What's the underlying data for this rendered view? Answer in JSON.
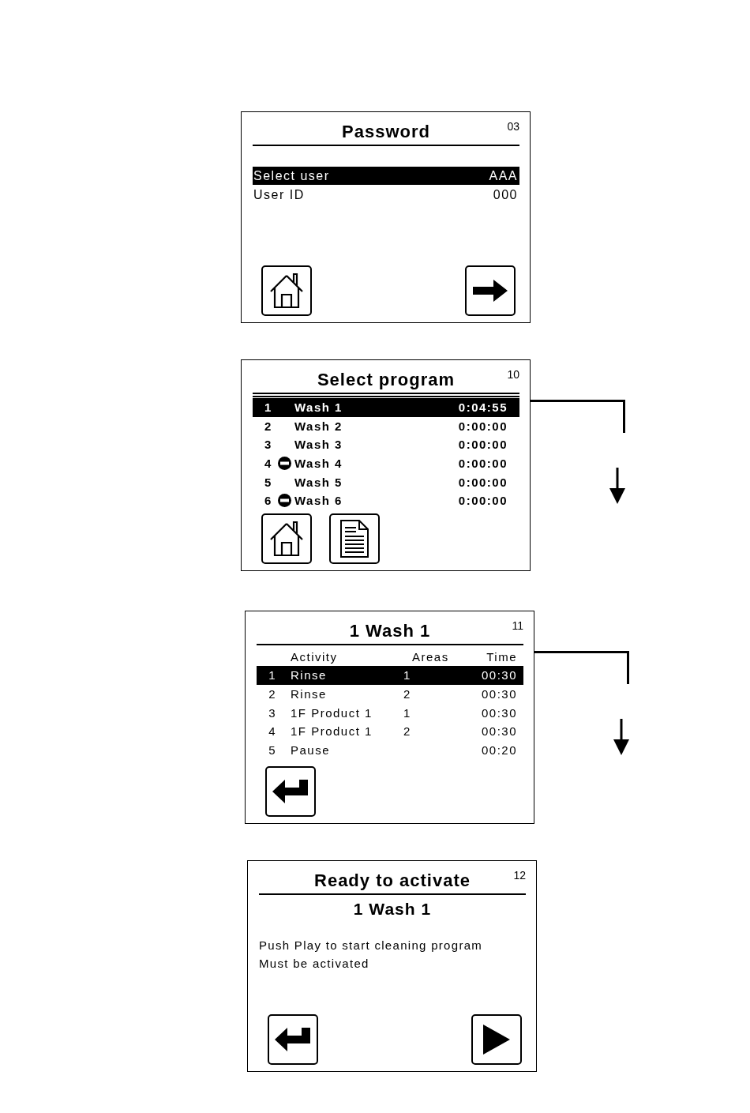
{
  "screens": [
    {
      "kind": "password",
      "number": "03",
      "title": "Password",
      "rows": [
        {
          "label": "Select user",
          "value": "AAA",
          "selected": true
        },
        {
          "label": "User ID",
          "value": "000",
          "selected": false
        }
      ],
      "buttons": [
        {
          "kind": "home"
        },
        {
          "kind": "next"
        }
      ]
    },
    {
      "kind": "program_list",
      "number": "10",
      "title": "Select program",
      "flow_arrow": true,
      "rows": [
        {
          "number": "1",
          "name": "Wash 1",
          "blocked": false,
          "time": "0:04:55",
          "selected": true
        },
        {
          "number": "2",
          "name": "Wash 2",
          "blocked": false,
          "time": "0:00:00",
          "selected": false
        },
        {
          "number": "3",
          "name": "Wash 3",
          "blocked": false,
          "time": "0:00:00",
          "selected": false
        },
        {
          "number": "4",
          "name": "Wash 4",
          "blocked": true,
          "time": "0:00:00",
          "selected": false
        },
        {
          "number": "5",
          "name": "Wash 5",
          "blocked": false,
          "time": "0:00:00",
          "selected": false
        },
        {
          "number": "6",
          "name": "Wash 6",
          "blocked": true,
          "time": "0:00:00",
          "selected": false
        }
      ],
      "buttons": [
        {
          "kind": "home"
        },
        {
          "kind": "document"
        }
      ]
    },
    {
      "kind": "activity_list",
      "number": "11",
      "title": "1 Wash 1",
      "flow_arrow": true,
      "columns": [
        "Activity",
        "Areas",
        "Time"
      ],
      "rows": [
        {
          "number": "1",
          "activity": "Rinse",
          "areas": "1",
          "time": "00:30",
          "selected": true
        },
        {
          "number": "2",
          "activity": "Rinse",
          "areas": "2",
          "time": "00:30",
          "selected": false
        },
        {
          "number": "3",
          "activity": "1F Product 1",
          "areas": "1",
          "time": "00:30",
          "selected": false
        },
        {
          "number": "4",
          "activity": "1F Product 1",
          "areas": "2",
          "time": "00:30",
          "selected": false
        },
        {
          "number": "5",
          "activity": "Pause",
          "time": "00:20",
          "selected": false
        }
      ],
      "buttons": [
        {
          "kind": "back"
        }
      ]
    },
    {
      "kind": "message",
      "number": "12",
      "title": "Ready to activate",
      "subtitle": "1 Wash 1",
      "lines": [
        "Push Play to start cleaning program",
        "Must be activated"
      ],
      "buttons": [
        {
          "kind": "back"
        },
        {
          "kind": "play"
        }
      ]
    }
  ]
}
